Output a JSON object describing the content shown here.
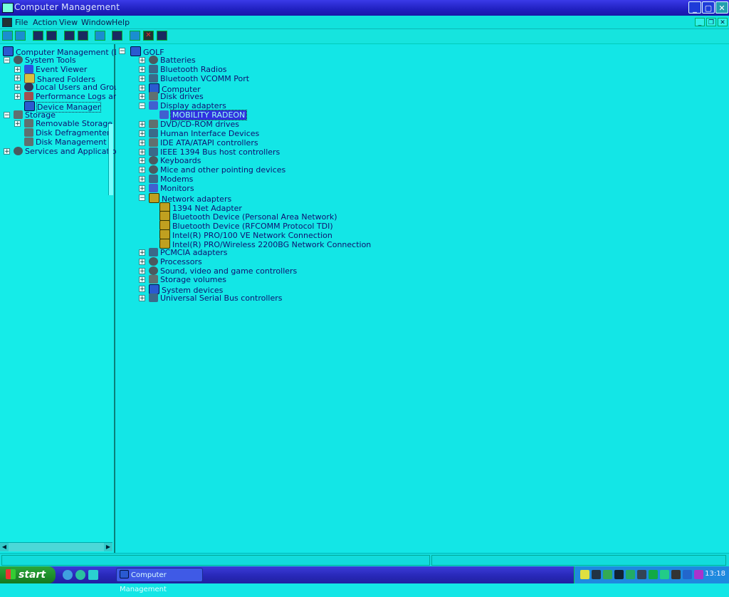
{
  "window": {
    "title": "Computer Management"
  },
  "menu": [
    "File",
    "Action",
    "View",
    "Window",
    "Help"
  ],
  "left_tree": [
    {
      "label": "Computer Management (Local)",
      "level": 0,
      "expander": "",
      "icon": "pc-icon"
    },
    {
      "label": "System Tools",
      "level": 1,
      "expander": "−",
      "icon": "gear-icon"
    },
    {
      "label": "Event Viewer",
      "level": 2,
      "expander": "+",
      "icon": "book-icon"
    },
    {
      "label": "Shared Folders",
      "level": 2,
      "expander": "+",
      "icon": "folder-icon"
    },
    {
      "label": "Local Users and Groups",
      "level": 2,
      "expander": "+",
      "icon": "users-icon"
    },
    {
      "label": "Performance Logs and Alerts",
      "level": 2,
      "expander": "+",
      "icon": "perf-icon"
    },
    {
      "label": "Device Manager",
      "level": 2,
      "expander": "",
      "icon": "pc-icon",
      "selected": true
    },
    {
      "label": "Storage",
      "level": 1,
      "expander": "−",
      "icon": "disk-icon"
    },
    {
      "label": "Removable Storage",
      "level": 2,
      "expander": "+",
      "icon": "disk-icon"
    },
    {
      "label": "Disk Defragmenter",
      "level": 2,
      "expander": "",
      "icon": "disk-icon"
    },
    {
      "label": "Disk Management",
      "level": 2,
      "expander": "",
      "icon": "disk-icon"
    },
    {
      "label": "Services and Applications",
      "level": 1,
      "expander": "+",
      "icon": "gear-icon"
    }
  ],
  "device_tree": {
    "root": "GOLF",
    "items": [
      {
        "label": "Batteries",
        "level": 1,
        "expander": "+",
        "icon": "gear-icon"
      },
      {
        "label": "Bluetooth Radios",
        "level": 1,
        "expander": "+",
        "icon": "usb-icon"
      },
      {
        "label": "Bluetooth VCOMM Port",
        "level": 1,
        "expander": "+",
        "icon": "usb-icon"
      },
      {
        "label": "Computer",
        "level": 1,
        "expander": "+",
        "icon": "pc-icon"
      },
      {
        "label": "Disk drives",
        "level": 1,
        "expander": "+",
        "icon": "disk-icon"
      },
      {
        "label": "Display adapters",
        "level": 1,
        "expander": "−",
        "icon": "mon-icon"
      },
      {
        "label": "MOBILITY RADEON",
        "level": 2,
        "expander": "",
        "icon": "mon-icon",
        "selected": true
      },
      {
        "label": "DVD/CD-ROM drives",
        "level": 1,
        "expander": "+",
        "icon": "disk-icon"
      },
      {
        "label": "Human Interface Devices",
        "level": 1,
        "expander": "+",
        "icon": "usb-icon"
      },
      {
        "label": "IDE ATA/ATAPI controllers",
        "level": 1,
        "expander": "+",
        "icon": "disk-icon"
      },
      {
        "label": "IEEE 1394 Bus host controllers",
        "level": 1,
        "expander": "+",
        "icon": "usb-icon"
      },
      {
        "label": "Keyboards",
        "level": 1,
        "expander": "+",
        "icon": "gear-icon"
      },
      {
        "label": "Mice and other pointing devices",
        "level": 1,
        "expander": "+",
        "icon": "gear-icon"
      },
      {
        "label": "Modems",
        "level": 1,
        "expander": "+",
        "icon": "usb-icon"
      },
      {
        "label": "Monitors",
        "level": 1,
        "expander": "+",
        "icon": "mon-icon"
      },
      {
        "label": "Network adapters",
        "level": 1,
        "expander": "−",
        "icon": "net-icon"
      },
      {
        "label": "1394 Net Adapter",
        "level": 2,
        "expander": "",
        "icon": "net-icon"
      },
      {
        "label": "Bluetooth Device (Personal Area Network)",
        "level": 2,
        "expander": "",
        "icon": "net-icon"
      },
      {
        "label": "Bluetooth Device (RFCOMM Protocol TDI)",
        "level": 2,
        "expander": "",
        "icon": "net-icon"
      },
      {
        "label": "Intel(R) PRO/100 VE Network Connection",
        "level": 2,
        "expander": "",
        "icon": "net-icon"
      },
      {
        "label": "Intel(R) PRO/Wireless 2200BG Network Connection",
        "level": 2,
        "expander": "",
        "icon": "net-icon"
      },
      {
        "label": "PCMCIA adapters",
        "level": 1,
        "expander": "+",
        "icon": "usb-icon"
      },
      {
        "label": "Processors",
        "level": 1,
        "expander": "+",
        "icon": "gear-icon"
      },
      {
        "label": "Sound, video and game controllers",
        "level": 1,
        "expander": "+",
        "icon": "gear-icon"
      },
      {
        "label": "Storage volumes",
        "level": 1,
        "expander": "+",
        "icon": "disk-icon"
      },
      {
        "label": "System devices",
        "level": 1,
        "expander": "+",
        "icon": "pc-icon"
      },
      {
        "label": "Universal Serial Bus controllers",
        "level": 1,
        "expander": "+",
        "icon": "usb-icon"
      }
    ]
  },
  "taskbar": {
    "start_label": "start",
    "task_label": "Computer Management",
    "clock": "13:18"
  },
  "colors": {
    "background": "#14e6e6",
    "selection": "#3030e0",
    "titlebar": "#2020c0",
    "start": "#2aa83a"
  }
}
